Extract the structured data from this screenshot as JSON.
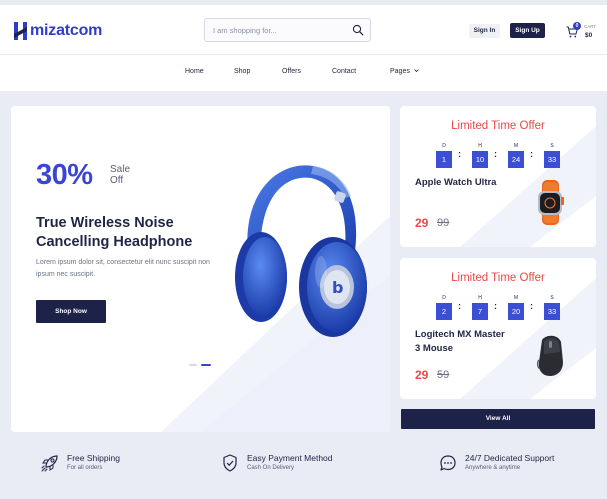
{
  "brand": {
    "name": "mizatcom",
    "logo_letter": "H",
    "color": "#2f3cc7"
  },
  "search": {
    "placeholder": "I am shopping for...",
    "icon": "search-icon"
  },
  "header": {
    "signin_label": "Sign In",
    "signup_label": "Sign Up",
    "cart": {
      "count": "0",
      "label": "CART",
      "total": "$0"
    }
  },
  "nav": {
    "items": [
      "Home",
      "Shop",
      "Offers",
      "Contact",
      "Pages"
    ]
  },
  "hero": {
    "discount": "30%",
    "sale_line1": "Sale",
    "sale_line2": "Off",
    "title": "True Wireless Noise Cancelling Headphone",
    "description": "Lorem ipsum dolor sit, consectetur elit nunc suscipit non ipsum nec suscipit.",
    "button_label": "Shop Now",
    "slides": 2,
    "active_slide": 2
  },
  "offers": [
    {
      "title": "Limited Time Offer",
      "timer": [
        {
          "label": "D",
          "value": "1"
        },
        {
          "label": "H",
          "value": "10"
        },
        {
          "label": "M",
          "value": "24"
        },
        {
          "label": "S",
          "value": "33"
        }
      ],
      "product": "Apple Watch Ultra",
      "price": "29",
      "old_price": "99",
      "image": "watch-image"
    },
    {
      "title": "Limited Time Offer",
      "timer": [
        {
          "label": "D",
          "value": "2"
        },
        {
          "label": "H",
          "value": "7"
        },
        {
          "label": "M",
          "value": "20"
        },
        {
          "label": "S",
          "value": "33"
        }
      ],
      "product": "Logitech MX Master 3 Mouse",
      "price": "29",
      "old_price": "59",
      "image": "mouse-image"
    }
  ],
  "view_all_label": "View All",
  "features": [
    {
      "title": "Free Shipping",
      "subtitle": "For all orders",
      "icon": "rocket-icon"
    },
    {
      "title": "Easy Payment Method",
      "subtitle": "Cash On Delivery",
      "icon": "shield-check-icon"
    },
    {
      "title": "24/7 Dedicated Support",
      "subtitle": "Anywhere & anytime",
      "icon": "chat-icon"
    }
  ],
  "colors": {
    "navy": "#1d2249",
    "accent": "#3a45d4",
    "offer_red": "#e94848",
    "page_bg": "#e9ebf5"
  }
}
